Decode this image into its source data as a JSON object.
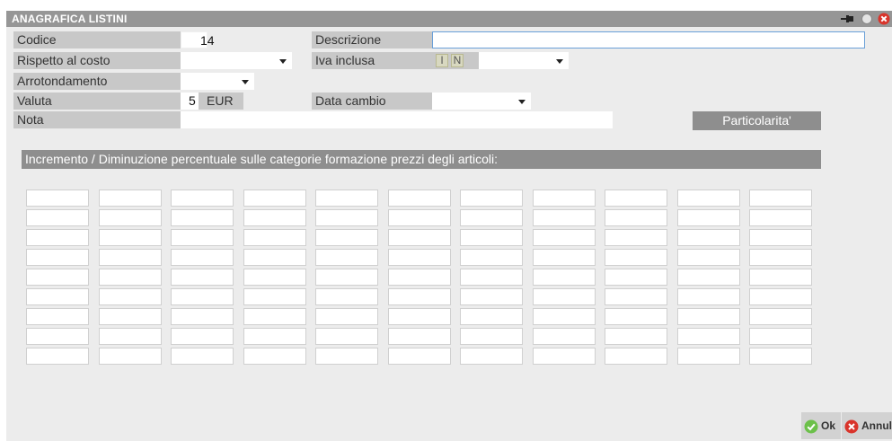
{
  "window": {
    "title": "ANAGRAFICA LISTINI"
  },
  "form": {
    "codice_label": "Codice",
    "codice_value": "14",
    "descrizione_label": "Descrizione",
    "descrizione_value": "",
    "rispetto_label": "Rispetto al costo",
    "rispetto_value": "",
    "iva_label": "Iva inclusa",
    "iva_opt_i": "I",
    "iva_opt_n": "N",
    "iva_value": "",
    "arrotondamento_label": "Arrotondamento",
    "arrotondamento_value": "",
    "valuta_label": "Valuta",
    "valuta_code": "5",
    "valuta_name": "EUR",
    "data_cambio_label": "Data cambio",
    "data_cambio_value": "",
    "nota_label": "Nota",
    "nota_value": ""
  },
  "buttons": {
    "particolarita": "Particolarita'",
    "ok": "Ok",
    "annulla": "Annulla"
  },
  "section": {
    "title": "Incremento / Diminuzione percentuale sulle categorie formazione prezzi degli articoli:"
  },
  "grid": {
    "columns": 11,
    "rows": 9
  },
  "icons": {
    "pin": "pin-icon",
    "circle": "circle-icon",
    "close": "close-icon",
    "ok": "check-icon",
    "cancel": "cancel-icon"
  },
  "colors": {
    "titlebar": "#969696",
    "ok_green": "#6cc04a",
    "close_red": "#d9342b"
  }
}
